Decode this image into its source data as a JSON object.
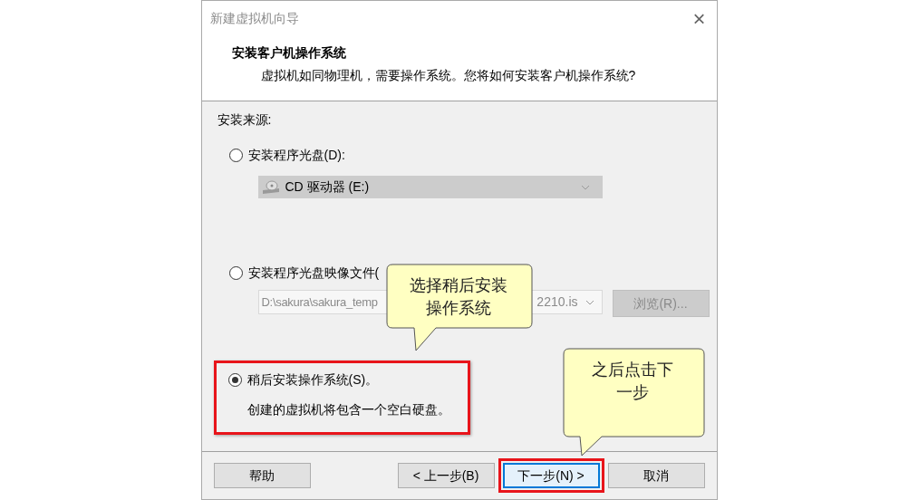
{
  "window": {
    "title": "新建虚拟机向导",
    "close": "×"
  },
  "header": {
    "title": "安装客户机操作系统",
    "subtitle": "虚拟机如同物理机，需要操作系统。您将如何安装客户机操作系统?"
  },
  "source_label": "安装来源:",
  "options": [
    {
      "kind": "disc",
      "label": "安装程序光盘(D):",
      "selected": false,
      "highlighted": false,
      "drive": "CD 驱动器 (E:)"
    },
    {
      "kind": "image",
      "label": "安装程序光盘映像文件(",
      "selected": false,
      "highlighted": false,
      "path_start": "D:\\sakura\\sakura_temp",
      "path_end": "2210.is",
      "browse": "浏览(R)..."
    },
    {
      "kind": "later",
      "label": "稍后安装操作系统(S)。",
      "selected": true,
      "highlighted": true,
      "note": "创建的虚拟机将包含一个空白硬盘。"
    }
  ],
  "buttons": [
    {
      "label": "帮助",
      "focused": false,
      "highlighted": false
    },
    {
      "label": "< 上一步(B)",
      "focused": false,
      "highlighted": false
    },
    {
      "label": "下一步(N) >",
      "focused": true,
      "highlighted": true
    },
    {
      "label": "取消",
      "focused": false,
      "highlighted": false
    }
  ],
  "callouts": [
    {
      "lines": [
        "选择稍后安装",
        "操作系统"
      ]
    },
    {
      "lines": [
        "之后点击下",
        "一步"
      ]
    }
  ]
}
